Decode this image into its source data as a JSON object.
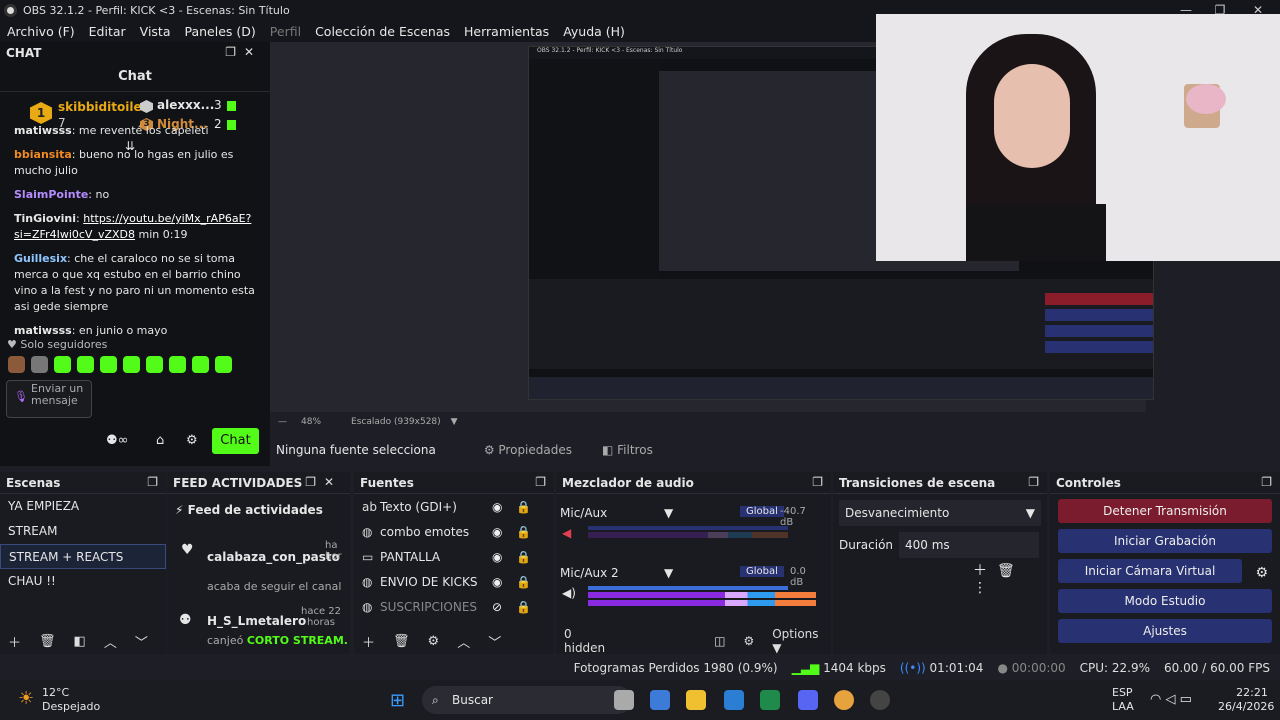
{
  "window": {
    "title": "OBS 32.1.2 - Perfil: KICK <3 - Escenas: Sin Título"
  },
  "menu": [
    "Archivo (F)",
    "Editar",
    "Vista",
    "Paneles (D)",
    "Perfil",
    "Colección de Escenas",
    "Herramientas",
    "Ayuda (H)"
  ],
  "chat": {
    "dock_title": "CHAT",
    "title": "Chat",
    "leader1": {
      "rank": "1",
      "name": "skibbiditoilet",
      "count": "7"
    },
    "leader2": {
      "name": "alexxx...",
      "count": "3"
    },
    "leader3": {
      "rank": "3",
      "name": "Night...",
      "count": "2"
    },
    "messages": [
      {
        "user": "matiwsss",
        "text": ": me reventé los capeleti",
        "color": "#e8e8e8"
      },
      {
        "user": "bbiansita",
        "text": ": bueno no lo hgas en julio es mucho julio",
        "color": "#f08a24"
      },
      {
        "user": "SlaimPointe",
        "text": ": no",
        "color": "#b48cff"
      },
      {
        "user": "TinGiovini",
        "text": ": ",
        "link": "https://youtu.be/yiMx_rAP6aE?si=ZFr4Iwi0cV_vZXD8",
        "tail": " min 0:19",
        "color": "#e8e8e8"
      },
      {
        "user": "Guillesix",
        "text": ": che el caraloco no se si toma merca o que xq estubo en el barrio chino vino a la fest y no paro ni un momento esta asi gede siempre",
        "color": "#8ec6ff"
      },
      {
        "user": "matiwsss",
        "text": ": en junio o mayo",
        "color": "#e8e8e8"
      }
    ],
    "followers_only": "Solo seguidores",
    "input_placeholder": "Enviar un mensaje",
    "send_label": "Chat"
  },
  "preview": {
    "zoom": "48%",
    "scale": "Escalado (939x528)",
    "no_source": "Ninguna fuente selecciona",
    "properties": "Propiedades",
    "filters": "Filtros"
  },
  "scenes": {
    "title": "Escenas",
    "items": [
      "YA EMPIEZA",
      "STREAM",
      "STREAM + REACTS",
      "CHAU !!"
    ],
    "selected": 2
  },
  "feed": {
    "title": "FEED ACTIVIDADES",
    "header": "Feed de actividades",
    "items": [
      {
        "user": "calabaza_con_pasto",
        "time": "ha hor",
        "text": "acaba de seguir el canal"
      },
      {
        "user": "H_S_Lmetalero",
        "time": "hace 22 horas",
        "text": "canjeó ",
        "highlight": "CORTO STREAM."
      }
    ]
  },
  "sources": {
    "title": "Fuentes",
    "items": [
      "Texto (GDI+)",
      "combo emotes",
      "PANTALLA",
      "ENVIO DE KICKS",
      "SUSCRIPCIONES"
    ]
  },
  "mixer": {
    "title": "Mezclador de audio",
    "ch1": {
      "name": "Mic/Aux",
      "mode": "Global",
      "db": "-40.7 dB"
    },
    "ch2": {
      "name": "Mic/Aux 2",
      "mode": "Global",
      "db": "0.0 dB"
    },
    "ticks": [
      "-60",
      "-54",
      "-48",
      "-42",
      "-36",
      "-30",
      "-24",
      "-18",
      "-12",
      "-6",
      "0"
    ],
    "hidden": "0 hidden",
    "options": "Options"
  },
  "transitions": {
    "title": "Transiciones de escena",
    "type": "Desvanecimiento",
    "duration_label": "Duración",
    "duration": "400 ms"
  },
  "controls": {
    "title": "Controles",
    "buttons": [
      "Detener Transmisión",
      "Iniciar Grabación",
      "Iniciar Cámara Virtual",
      "Modo Estudio",
      "Ajustes"
    ]
  },
  "status": {
    "dropped": "Fotogramas Perdidos 1980 (0.9%)",
    "kbps": "1404 kbps",
    "stream_time": "01:01:04",
    "rec_time": "00:00:00",
    "cpu": "CPU: 22.9%",
    "fps": "60.00 / 60.00 FPS"
  },
  "taskbar": {
    "weather_temp": "12°C",
    "weather_desc": "Despejado",
    "search": "Buscar",
    "lang1": "ESP",
    "lang2": "LAA",
    "time": "22:21",
    "date": "26/4/2026"
  }
}
